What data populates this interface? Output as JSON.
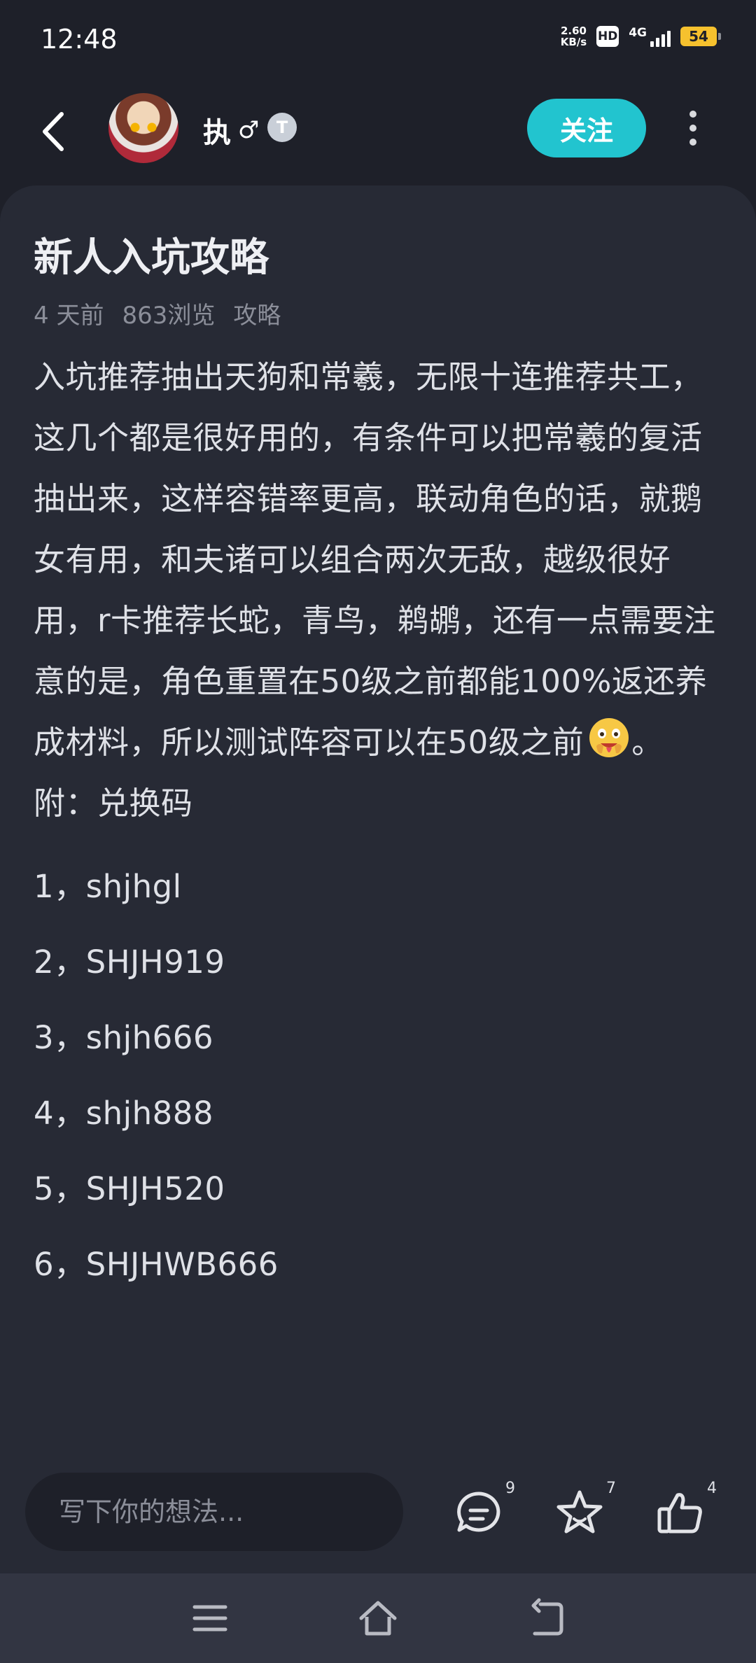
{
  "status_bar": {
    "time": "12:48",
    "net_speed_value": "2.60",
    "net_speed_unit": "KB/s",
    "hd_label": "HD",
    "signal_label": "4G",
    "battery": "54"
  },
  "header": {
    "username": "执",
    "gender_symbol": "♂",
    "level_badge": "T",
    "follow_label": "关注"
  },
  "post": {
    "title": "新人入坑攻略",
    "time_ago": "4 天前",
    "views": "863浏览",
    "category": "攻略",
    "paragraph_main": "入坑推荐抽出天狗和常羲，无限十连推荐共工，这几个都是很好用的，有条件可以把常羲的复活抽出来，这样容错率更高，联动角色的话，就鹅女有用，和夫诸可以组合两次无敌，越级很好用，r卡推荐长蛇，青鸟，鹈鹕，还有一点需要注意的是，角色重置在50级之前都能100%返还养成材料，所以测试阵容可以在50级之前",
    "paragraph_end": "。",
    "appendix_label": "附：兑换码",
    "codes": [
      "1，shjhgl",
      "2，SHJH919",
      "3，shjh666",
      "4，shjh888",
      "5，SHJH520",
      "6，SHJHWB666"
    ]
  },
  "comment_bar": {
    "placeholder": "写下你的想法...",
    "comment_count": "9",
    "favorite_count": "7",
    "like_count": "4"
  },
  "icons": {
    "back": "back-arrow-icon",
    "more": "more-vertical-icon",
    "emoji": "drooling-face-emoji-icon",
    "comment": "comment-icon",
    "favorite": "star-icon",
    "like": "thumbs-up-icon",
    "menu": "menu-icon",
    "home": "home-icon",
    "return": "return-icon"
  },
  "colors": {
    "background": "#1e2029",
    "card": "#272a35",
    "accent": "#22c4cf",
    "battery": "#f6c12e",
    "navbar": "#323542"
  }
}
